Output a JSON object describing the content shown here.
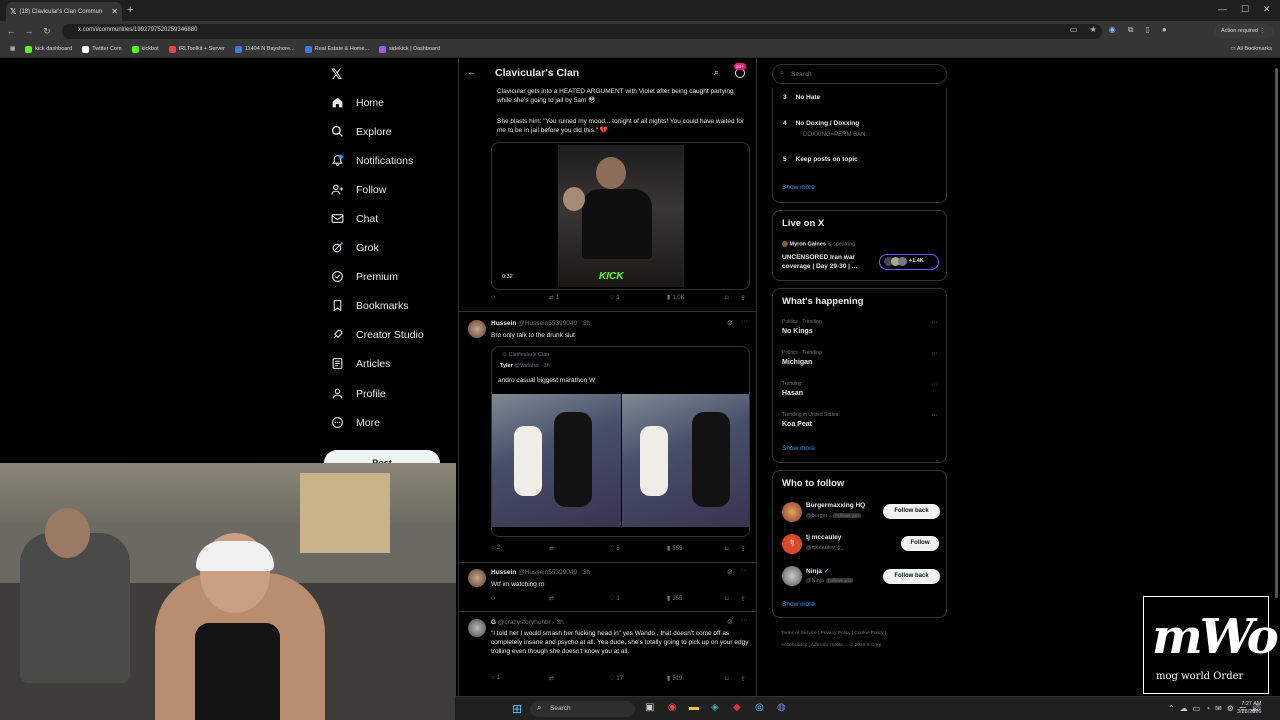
{
  "browser": {
    "tab_title": "(18) Clavicular's Clan Commun",
    "url": "x.com/i/communities/1992797520259346880",
    "action_required": "Action required",
    "bookmarks": [
      "kick dashboard",
      "Twitter Com",
      "kickbot",
      "IRLToolkit + Server",
      "11404 N Bayshore...",
      "Real Estate & Home...",
      "sidekick | Dashboard"
    ],
    "all_bookmarks": "All Bookmarks"
  },
  "sidebar": {
    "items": [
      {
        "label": "Home",
        "icon": "home-icon"
      },
      {
        "label": "Explore",
        "icon": "search-icon"
      },
      {
        "label": "Notifications",
        "icon": "bell-icon"
      },
      {
        "label": "Follow",
        "icon": "person-plus-icon"
      },
      {
        "label": "Chat",
        "icon": "mail-icon"
      },
      {
        "label": "Grok",
        "icon": "grok-icon"
      },
      {
        "label": "Premium",
        "icon": "premium-icon"
      },
      {
        "label": "Bookmarks",
        "icon": "bookmark-icon"
      },
      {
        "label": "Creator Studio",
        "icon": "rocket-icon"
      },
      {
        "label": "Articles",
        "icon": "article-icon"
      },
      {
        "label": "Profile",
        "icon": "person-icon"
      },
      {
        "label": "More",
        "icon": "more-circle-icon"
      }
    ],
    "post_label": "Post",
    "notif_badge": ""
  },
  "feed": {
    "title": "Clavicular's Clan",
    "badge": "20+",
    "post1": {
      "text1": "Clavicular gets into a HEATED ARGUMENT with Violet after being caught partying while she's going to jail by 5am 😳",
      "text2": "She blasts him: \"You ruined my mood... tonight of all nights! You could have waited for me to be in jail before you did this.\" 💔",
      "duration": "0:32",
      "video_watermark": "KICK",
      "replies": "",
      "reposts": "1",
      "likes": "1",
      "views": "1.0K"
    },
    "post2": {
      "name": "Hussein",
      "handle": "@Hussein55399049 · 3h",
      "text": "Bro only talk to the drunk slut",
      "quote_community": "Clavicular's Clan",
      "quote_name": "Tyler",
      "quote_handle": "@Vaitalss · 3h",
      "quote_text": "andro casual biggest marathon W",
      "replies": "2",
      "reposts": "",
      "likes": "3",
      "views": "555"
    },
    "post3": {
      "name": "Hussein",
      "handle": "@Hussein55399049 · 3h",
      "text": "Wtf im watching rn",
      "replies": "",
      "reposts": "",
      "likes": "1",
      "views": "355"
    },
    "post4": {
      "name": "G",
      "handle": "@crazystoryhuhbr · 3h",
      "text": "\"I told her I would smash her fucking head in\" yes Wando , that doesn't come off as completely insane and psycho at all. Yea dude, she's totally going to pick up on your edgy trolling even though she doesn't know you at all.",
      "replies": "1",
      "reposts": "",
      "likes": "17",
      "views": "519"
    }
  },
  "right": {
    "search_placeholder": "Search",
    "rules": [
      {
        "num": "3",
        "title": "No Hate",
        "sub": ""
      },
      {
        "num": "4",
        "title": "No Doxing / Doxxing",
        "sub": "DOXXING=PERM BAN"
      },
      {
        "num": "5",
        "title": "Keep posts on topic",
        "sub": ""
      }
    ],
    "show_more": "Show more",
    "live_title": "Live on X",
    "live_host": "Myron Gaines",
    "live_status": "is speaking",
    "live_text": "UNCENSORED Iran war coverage | Day 29-30 | ...",
    "live_count": "+1.4K",
    "happening_title": "What's happening",
    "trends": [
      {
        "meta": "Politics · Trending",
        "name": "No Kings"
      },
      {
        "meta": "Politics · Trending",
        "name": "Michigan"
      },
      {
        "meta": "Trending",
        "name": "Hasan"
      },
      {
        "meta": "Trending in United States",
        "name": "Koa Peat"
      }
    ],
    "wtf_title": "Who to follow",
    "follows": [
      {
        "name": "Burgermaxxing HQ",
        "handle": "@burger...",
        "follows_you": "Follows you",
        "button": "Follow back"
      },
      {
        "name": "tj mccauley",
        "handle": "@mccauley_jr_",
        "follows_you": "",
        "button": "Follow"
      },
      {
        "name": "Ninja",
        "handle": "@Ninja",
        "follows_you": "Follows you",
        "button": "Follow back"
      }
    ],
    "footer": [
      "Terms of Service",
      "Privacy Policy",
      "Cookie Policy",
      "Accessibility",
      "Ads info",
      "More ...",
      "© 2026 X Corp."
    ]
  },
  "overlay": {
    "mwo_text": "mWo",
    "mwo_sub": "mog world Order"
  },
  "taskbar": {
    "search": "Search",
    "time": "7:27 AM",
    "date": "3/28/2026"
  }
}
